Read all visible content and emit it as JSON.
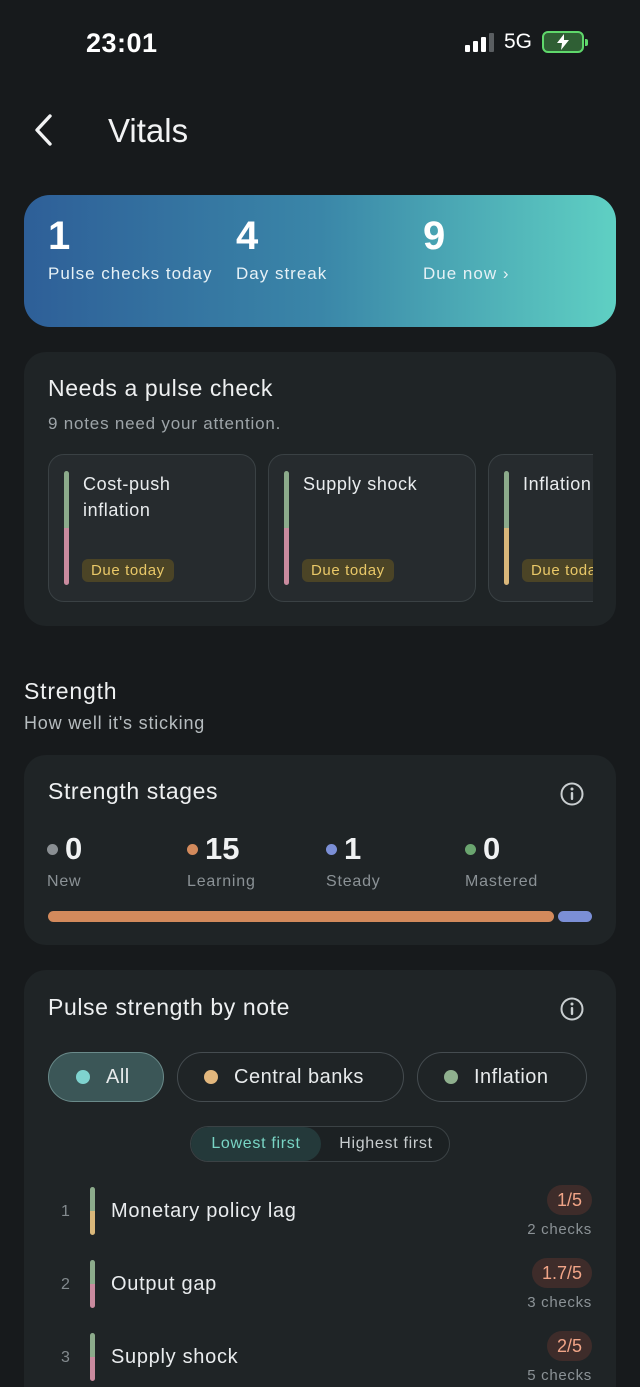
{
  "status_bar": {
    "time": "23:01",
    "network": "5G"
  },
  "header": {
    "title": "Vitals"
  },
  "summary": {
    "stats": [
      {
        "value": "1",
        "label": "Pulse checks today"
      },
      {
        "value": "4",
        "label": "Day streak"
      },
      {
        "value": "9",
        "label": "Due now ›"
      }
    ]
  },
  "pulse_check": {
    "title": "Needs a pulse check",
    "subtitle": "9 notes need your attention.",
    "notes": [
      {
        "name": "Cost-push inflation",
        "due": "Due today",
        "accent": "#c98a9e"
      },
      {
        "name": "Supply shock",
        "due": "Due today",
        "accent": "#c98a9e"
      },
      {
        "name": "Inflation",
        "due": "Due today",
        "accent": "#d9b77a"
      }
    ]
  },
  "strength_section": {
    "title": "Strength",
    "subtitle": "How well it's sticking"
  },
  "strength_stages": {
    "title": "Strength stages",
    "stages": [
      {
        "value": "0",
        "label": "New",
        "color": "#8a8f93"
      },
      {
        "value": "15",
        "label": "Learning",
        "color": "#d38a5c"
      },
      {
        "value": "1",
        "label": "Steady",
        "color": "#7b8fd6"
      },
      {
        "value": "0",
        "label": "Mastered",
        "color": "#6aa56f"
      }
    ]
  },
  "pulse_strength": {
    "title": "Pulse strength by note",
    "filters": [
      {
        "label": "All",
        "color": "#7fd3cf",
        "active": true
      },
      {
        "label": "Central banks",
        "color": "#e2b77d",
        "active": false
      },
      {
        "label": "Inflation",
        "color": "#8fb08e",
        "active": false
      }
    ],
    "sort": {
      "lowest": "Lowest first",
      "highest": "Highest first",
      "selected": "lowest"
    },
    "notes": [
      {
        "rank": "1",
        "name": "Monetary policy lag",
        "score": "1/5",
        "checks": "2 checks",
        "accent": "#d9b77a"
      },
      {
        "rank": "2",
        "name": "Output gap",
        "score": "1.7/5",
        "checks": "3 checks",
        "accent": "#c98a9e"
      },
      {
        "rank": "3",
        "name": "Supply shock",
        "score": "2/5",
        "checks": "5 checks",
        "accent": "#c98a9e"
      }
    ]
  }
}
